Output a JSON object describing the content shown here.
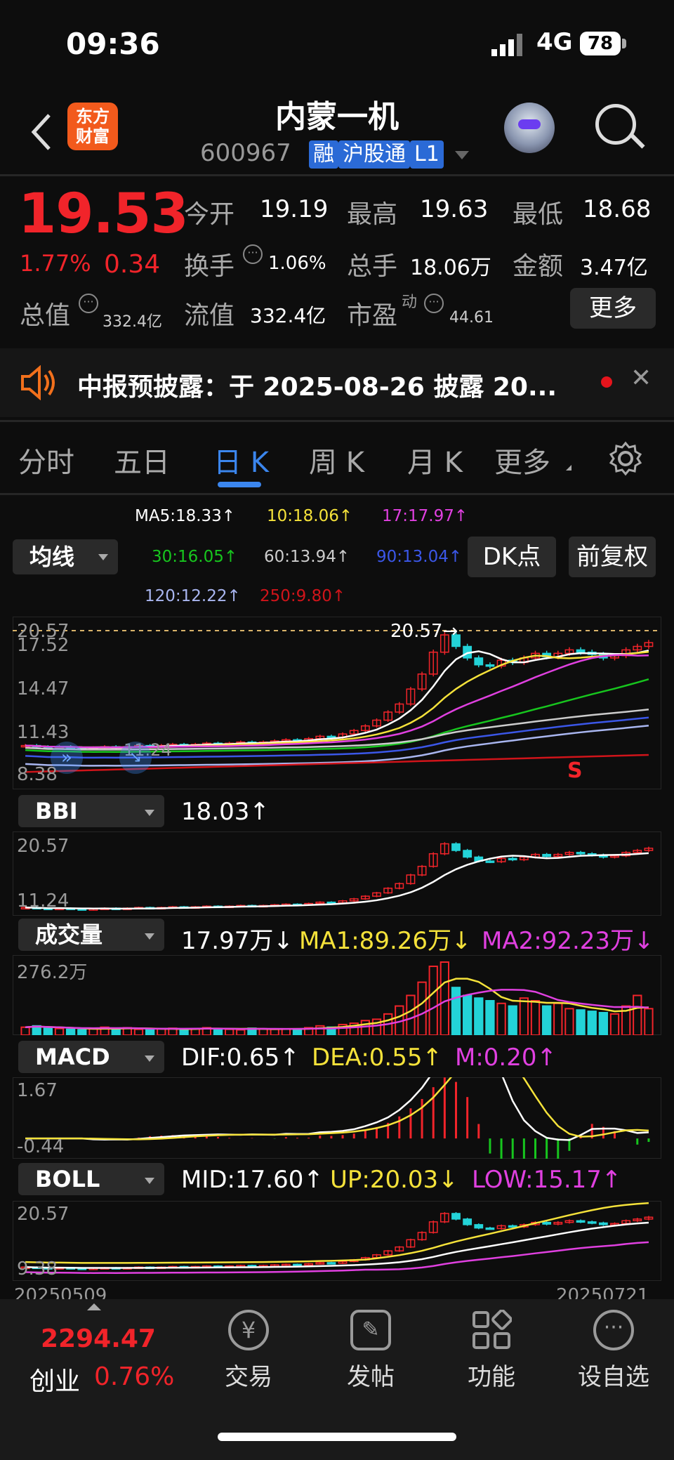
{
  "status": {
    "time": "09:36",
    "network": "4G",
    "battery": "78"
  },
  "header": {
    "name": "内蒙一机",
    "code": "600967",
    "tags": [
      "融",
      "沪股通",
      "L1"
    ],
    "logo_line1": "东方",
    "logo_line2": "财富"
  },
  "quote": {
    "price": "19.53",
    "pct": "1.77%",
    "chg": "0.34",
    "open_label": "今开",
    "open": "19.19",
    "high_label": "最高",
    "high": "19.63",
    "low_label": "最低",
    "low": "18.68",
    "turn_label": "换手",
    "turn": "1.06%",
    "vol_label": "总手",
    "vol": "18.06万",
    "amt_label": "金额",
    "amt": "3.47亿",
    "mcap_label": "总值",
    "mcap": "332.4亿",
    "float_label": "流值",
    "float": "332.4亿",
    "pe_label": "市盈",
    "pe_sup": "动",
    "pe": "44.61",
    "more": "更多"
  },
  "notice": {
    "text": "中报预披露：于 2025-08-26 披露 20..."
  },
  "tabs": [
    "分时",
    "五日",
    "日 K",
    "周 K",
    "月 K",
    "更多"
  ],
  "ma": {
    "ma5": "MA5:18.33↑",
    "ma10": "10:18.06↑",
    "ma17": "17:17.97↑",
    "ma30": "30:16.05↑",
    "ma60": "60:13.94↑",
    "ma90": "90:13.04↑",
    "ma120": "120:12.22↑",
    "ma250": "250:9.80↑",
    "selector": "均线",
    "dk": "DK点",
    "adj": "前复权"
  },
  "colors": {
    "up": "#f1242a",
    "down": "#23d3d8",
    "ma5": "#ffffff",
    "ma10": "#f5e23a",
    "ma17": "#e040e0",
    "ma30": "#17c51e",
    "ma60": "#cccccc",
    "ma90": "#3b57e8",
    "ma120": "#a9b6f0",
    "ma250": "#d0141a"
  },
  "main_chart": {
    "label_high": "20.57",
    "labels": [
      "20.57",
      "17.52",
      "14.47",
      "11.43",
      "8.38"
    ],
    "low_mark": "11.24",
    "s_mark": "S"
  },
  "bbi": {
    "selector": "BBI",
    "value": "18.03↑",
    "labels": [
      "20.57",
      "11.24"
    ]
  },
  "volume": {
    "selector": "成交量",
    "value": "17.97万↓",
    "ma1": "MA1:89.26万↓",
    "ma2": "MA2:92.23万↓",
    "top": "276.2万"
  },
  "macd": {
    "selector": "MACD",
    "dif": "DIF:0.65↑",
    "dea": "DEA:0.55↑",
    "m": "M:0.20↑",
    "top": "1.67",
    "bottom": "-0.44"
  },
  "boll": {
    "selector": "BOLL",
    "mid": "MID:17.60↑",
    "up": "UP:20.03↓",
    "low": "LOW:15.17↑",
    "top": "20.57",
    "bottom": "9.38",
    "date_start": "20250509",
    "date_end": "20250721"
  },
  "bottom": {
    "index_value": "2294.47",
    "index_name": "创业",
    "index_pct": "0.76%",
    "nav": [
      "交易",
      "发帖",
      "功能",
      "设自选"
    ]
  },
  "chart_data": {
    "type": "candlestick",
    "closes": [
      10.6,
      10.5,
      10.4,
      10.5,
      10.4,
      10.3,
      10.4,
      10.5,
      10.4,
      10.5,
      10.6,
      10.5,
      10.6,
      10.7,
      10.6,
      10.7,
      10.8,
      10.7,
      10.8,
      10.9,
      10.8,
      10.9,
      11.0,
      11.1,
      11.0,
      11.2,
      11.4,
      11.3,
      11.6,
      11.9,
      12.3,
      12.8,
      13.5,
      14.2,
      15.5,
      16.8,
      18.7,
      20.2,
      19.2,
      18.2,
      17.6,
      17.5,
      18.0,
      17.8,
      18.2,
      18.6,
      18.3,
      18.6,
      18.9,
      18.7,
      18.5,
      18.2,
      18.4,
      18.9,
      19.2,
      19.53
    ],
    "volumes": [
      30,
      35,
      28,
      25,
      22,
      20,
      24,
      30,
      26,
      28,
      22,
      20,
      24,
      26,
      22,
      24,
      28,
      25,
      22,
      20,
      26,
      24,
      22,
      24,
      22,
      28,
      35,
      30,
      40,
      45,
      55,
      60,
      80,
      110,
      150,
      200,
      260,
      276,
      180,
      150,
      140,
      130,
      120,
      110,
      140,
      130,
      110,
      120,
      100,
      95,
      90,
      85,
      80,
      110,
      150,
      100
    ]
  }
}
